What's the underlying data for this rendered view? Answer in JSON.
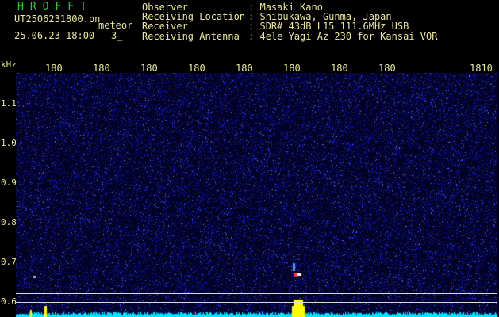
{
  "header": {
    "app_title": "HROFFT",
    "filename": "UT2506231800.pn",
    "kind": "meteor",
    "timestamp": "25.06.23 18:00",
    "page_index": "3_",
    "observer": {
      "key": "Observer",
      "sep": ":",
      "value": "Masaki Kano"
    },
    "location": {
      "key": "Receiving Location",
      "sep": ":",
      "value": "Shibukawa, Gunma, Japan"
    },
    "receiver": {
      "key": "Receiver",
      "sep": ":",
      "value": "SDR# 43dB L15 111.6MHz USB"
    },
    "antenna": {
      "key": "Receiving Antenna",
      "sep": ":",
      "value": "4ele Yagi Az 230 for Kansai VOR"
    }
  },
  "axis": {
    "y_unit": "kHz",
    "y_ticks": [
      "1.1",
      "1.0",
      "0.9",
      "0.8",
      "0.7",
      "0.6"
    ],
    "x_ticks": [
      "180",
      "180",
      "180",
      "180",
      "180",
      "180",
      "180",
      "180",
      "1810"
    ]
  },
  "colors": {
    "background": "#000000",
    "noise": "#1e22c8",
    "spectrum": "#00e5ff",
    "echo": "#ffff00",
    "text": "#e8e89a",
    "title": "#2ecc2e"
  }
}
